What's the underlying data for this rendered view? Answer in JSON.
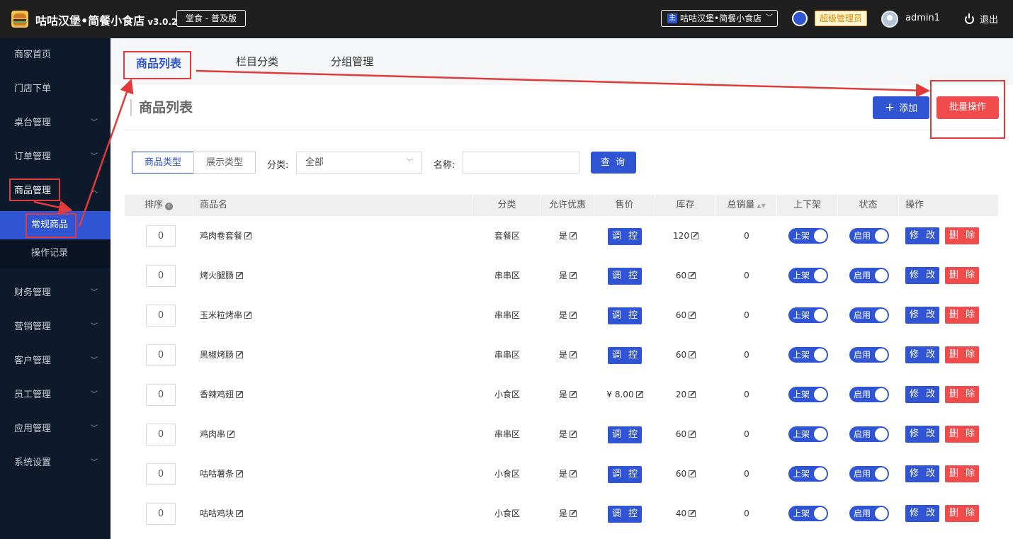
{
  "app": {
    "brand": "咕咕汉堡•简餐小食店",
    "version": "v3.0.2",
    "edition": "堂食 - 普及版",
    "store_badge": "主",
    "store_name": "咕咕汉堡•简餐小食店",
    "role": "超级管理员",
    "username": "admin1",
    "logout": "退出"
  },
  "sidebar": {
    "items": [
      {
        "label": "商家首页",
        "arrow": ""
      },
      {
        "label": "门店下单",
        "arrow": ""
      },
      {
        "label": "桌台管理",
        "arrow": "﹀"
      },
      {
        "label": "订单管理",
        "arrow": "﹀"
      },
      {
        "label": "商品管理",
        "arrow": "︿"
      },
      {
        "label": "财务管理",
        "arrow": "﹀"
      },
      {
        "label": "营销管理",
        "arrow": "﹀"
      },
      {
        "label": "客户管理",
        "arrow": "﹀"
      },
      {
        "label": "员工管理",
        "arrow": "﹀"
      },
      {
        "label": "应用管理",
        "arrow": "﹀"
      },
      {
        "label": "系统设置",
        "arrow": "﹀"
      }
    ],
    "sub_items": [
      {
        "label": "常规商品"
      },
      {
        "label": "操作记录"
      }
    ]
  },
  "tabs": [
    {
      "label": "商品列表"
    },
    {
      "label": "栏目分类"
    },
    {
      "label": "分组管理"
    }
  ],
  "page": {
    "title": "商品列表",
    "add_label": "添加",
    "batch_label": "批量操作"
  },
  "filter": {
    "seg_goods_type": "商品类型",
    "seg_display_type": "展示类型",
    "category_label": "分类:",
    "category_value": "全部",
    "name_label": "名称:",
    "name_value": "",
    "name_placeholder": "",
    "query_label": "查 询"
  },
  "table": {
    "headers": [
      "排序",
      "商品名",
      "分类",
      "允许优惠",
      "售价",
      "库存",
      "总销量",
      "上下架",
      "状态",
      "操作"
    ],
    "tune_label": "调 控",
    "shelf_label": "上架",
    "status_label": "启用",
    "edit_label": "修 改",
    "delete_label": "删 除",
    "rows": [
      {
        "sort": "0",
        "name": "鸡肉卷套餐",
        "category": "套餐区",
        "discount": "是",
        "price": "",
        "stock": "120",
        "sales": "0"
      },
      {
        "sort": "0",
        "name": "烤火腿肠",
        "category": "串串区",
        "discount": "是",
        "price": "",
        "stock": "60",
        "sales": "0"
      },
      {
        "sort": "0",
        "name": "玉米粒烤串",
        "category": "串串区",
        "discount": "是",
        "price": "",
        "stock": "60",
        "sales": "0"
      },
      {
        "sort": "0",
        "name": "黑椒烤肠",
        "category": "串串区",
        "discount": "是",
        "price": "",
        "stock": "60",
        "sales": "0"
      },
      {
        "sort": "0",
        "name": "香辣鸡翅",
        "category": "小食区",
        "discount": "是",
        "price": "¥ 8.00",
        "stock": "20",
        "sales": "0"
      },
      {
        "sort": "0",
        "name": "鸡肉串",
        "category": "串串区",
        "discount": "是",
        "price": "",
        "stock": "60",
        "sales": "0"
      },
      {
        "sort": "0",
        "name": "咕咕薯条",
        "category": "小食区",
        "discount": "是",
        "price": "",
        "stock": "60",
        "sales": "0"
      },
      {
        "sort": "0",
        "name": "咕咕鸡块",
        "category": "小食区",
        "discount": "是",
        "price": "",
        "stock": "40",
        "sales": "0"
      }
    ]
  },
  "colors": {
    "primary": "#2f55d4",
    "danger": "#f24b4b",
    "annotation": "#e23a3a",
    "sidebar_bg": "#0d1a2b"
  }
}
